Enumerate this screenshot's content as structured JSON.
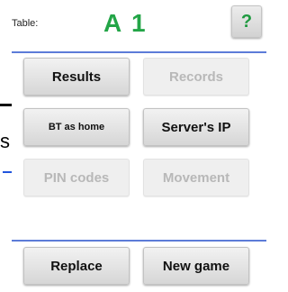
{
  "header": {
    "table_label": "Table:",
    "table_value": "A 1",
    "help_label": "?"
  },
  "left_edge": {
    "glyph": "s"
  },
  "buttons": {
    "results": "Results",
    "records": "Records",
    "bt_as_home": "BT as home",
    "servers_ip": "Server's IP",
    "pin_codes": "PIN codes",
    "movement": "Movement",
    "replace": "Replace",
    "new_game": "New game"
  },
  "colors": {
    "accent_green": "#23a547",
    "divider_blue": "#5c7cd8",
    "disabled_text": "#b8b8b8"
  }
}
